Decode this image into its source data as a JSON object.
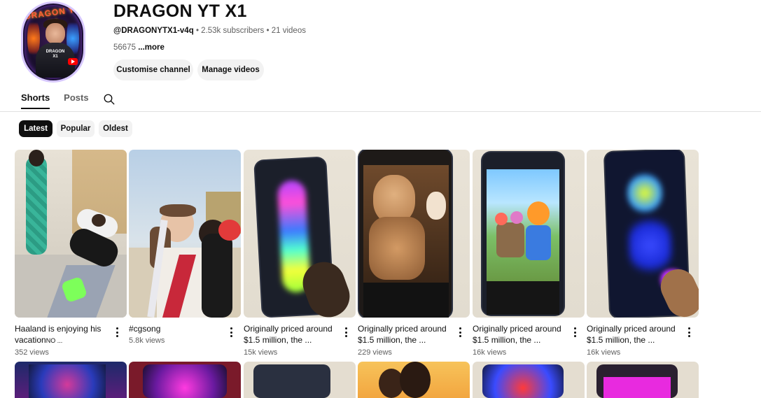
{
  "channel": {
    "title": "DRAGON YT X1",
    "handle": "@DRAGONYTX1-v4q",
    "subscribers": "2.53k subscribers",
    "videos": "21 videos",
    "about": "56675",
    "more_label": "...more",
    "avatar_text": "DRAGON YT X1",
    "avatar_label": "DRAGON X1"
  },
  "buttons": {
    "customise": "Customise channel",
    "manage": "Manage videos"
  },
  "tabs": [
    {
      "label": "Shorts",
      "active": true
    },
    {
      "label": "Posts",
      "active": false
    }
  ],
  "chips": [
    {
      "label": "Latest",
      "active": true
    },
    {
      "label": "Popular",
      "active": false
    },
    {
      "label": "Oldest",
      "active": false
    }
  ],
  "shorts": [
    {
      "title": "Haaland is enjoying his vacation",
      "title_suffix": "NO ...",
      "views": "352 views"
    },
    {
      "title": "#cgsong",
      "title_suffix": "",
      "views": "5.8k views"
    },
    {
      "title": "Originally priced around $1.5 million, the ...",
      "title_suffix": "",
      "views": "15k views"
    },
    {
      "title": "Originally priced around $1.5 million, the ...",
      "title_suffix": "",
      "views": "229 views"
    },
    {
      "title": "Originally priced around $1.5 million, the ...",
      "title_suffix": "",
      "views": "16k views"
    },
    {
      "title": "Originally priced around $1.5 million, the ...",
      "title_suffix": "",
      "views": "16k views"
    }
  ],
  "colors": {
    "accent": "#0f0f0f",
    "chip_bg": "#f2f2f2",
    "secondary_text": "#606060"
  }
}
